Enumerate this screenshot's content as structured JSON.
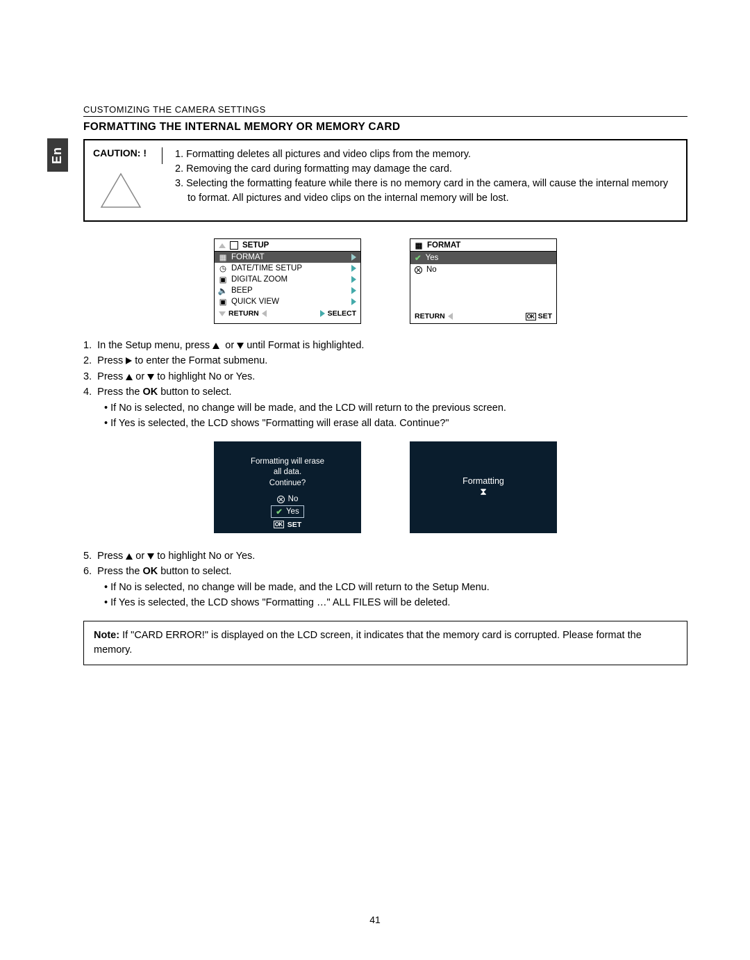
{
  "lang_tab": "En",
  "topline": "CUSTOMIZING THE CAMERA SETTINGS",
  "section_title": "FORMATTING THE INTERNAL MEMORY OR MEMORY CARD",
  "caution": {
    "label": "CAUTION: !",
    "items": [
      "1.  Formatting deletes all pictures and video clips from the memory.",
      "2.  Removing the card during formatting may damage the card.",
      "3.  Selecting the formatting feature while there is no memory card in the camera, will cause the internal memory to format. All pictures and video clips on the internal memory will be lost."
    ]
  },
  "lcd_setup": {
    "title": "SETUP",
    "items": [
      {
        "label": "FORMAT",
        "selected": true
      },
      {
        "label": "DATE/TIME SETUP",
        "selected": false
      },
      {
        "label": "DIGITAL ZOOM",
        "selected": false
      },
      {
        "label": "BEEP",
        "selected": false
      },
      {
        "label": "QUICK VIEW",
        "selected": false
      }
    ],
    "footer_left": "RETURN",
    "footer_right": "SELECT"
  },
  "lcd_format": {
    "title": "FORMAT",
    "items": [
      {
        "label": "Yes",
        "selected": true,
        "icon": "check"
      },
      {
        "label": "No",
        "selected": false,
        "icon": "x"
      }
    ],
    "footer_left": "RETURN",
    "footer_right": "SET",
    "footer_right_prefix": "OK"
  },
  "steps1": [
    "1.  In the Setup menu, press ▲  or ▼ until Format is highlighted.",
    "2.  Press ▶ to enter the Format submenu.",
    "3.  Press ▲ or ▼ to highlight No or Yes.",
    "4.  Press the OK button to select."
  ],
  "steps1_sub": [
    "•  If No is selected, no change will be made, and the LCD will return to the previous screen.",
    "•  If Yes is selected, the LCD shows \"Formatting will erase all data. Continue?\""
  ],
  "confirm_screen": {
    "msg1": "Formatting will erase",
    "msg2": "all data.",
    "msg3": "Continue?",
    "opt_no": "No",
    "opt_yes": "Yes",
    "footer": "SET",
    "footer_prefix": "OK"
  },
  "progress_screen": {
    "label": "Formatting"
  },
  "steps2": [
    "5.  Press ▲ or ▼ to highlight No or Yes.",
    "6.  Press the OK button to select."
  ],
  "steps2_sub": [
    "•  If No is selected, no change will be made, and the LCD will return to the Setup Menu.",
    "•  If Yes is selected, the LCD shows \"Formatting …\" ALL FILES will be deleted."
  ],
  "note": {
    "label": "Note:",
    "text": " If \"CARD ERROR!\" is displayed on the LCD screen, it indicates that the memory card is corrupted. Please format the memory."
  },
  "page": "41"
}
